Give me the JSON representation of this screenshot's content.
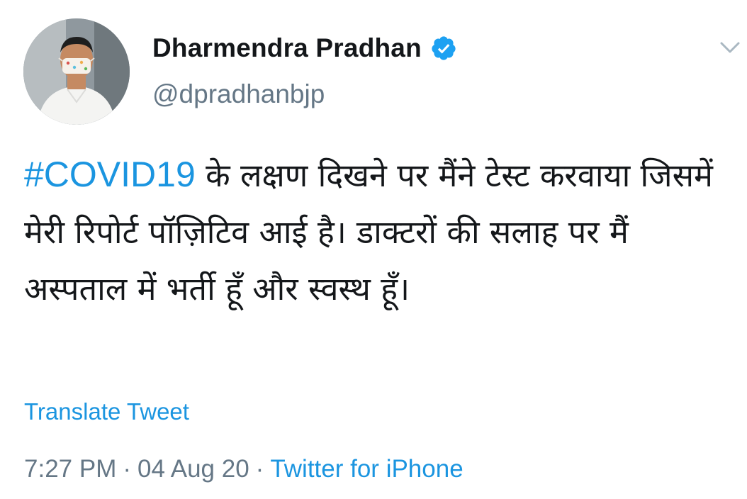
{
  "tweet": {
    "author": {
      "name": "Dharmendra Pradhan",
      "handle": "@dpradhanbjp",
      "verified_icon": "verified-badge-icon",
      "avatar": "profile-photo"
    },
    "menu_icon": "chevron-down-icon",
    "hashtag": "#COVID19",
    "text_after_hashtag": " के लक्षण दिखने पर मैंने टेस्ट करवाया जिसमें मेरी रिपोर्ट पॉज़िटिव आई है। डाक्टरों की सलाह पर मैं अस्पताल में भर्ती हूँ और स्वस्थ हूँ।",
    "translate_label": "Translate Tweet",
    "time": "7:27 PM",
    "separator": "·",
    "date": "04 Aug 20",
    "source": "Twitter for iPhone"
  },
  "colors": {
    "link": "#1b95e0",
    "secondary_text": "#657786",
    "primary_text": "#14171a",
    "background": "#ffffff"
  }
}
